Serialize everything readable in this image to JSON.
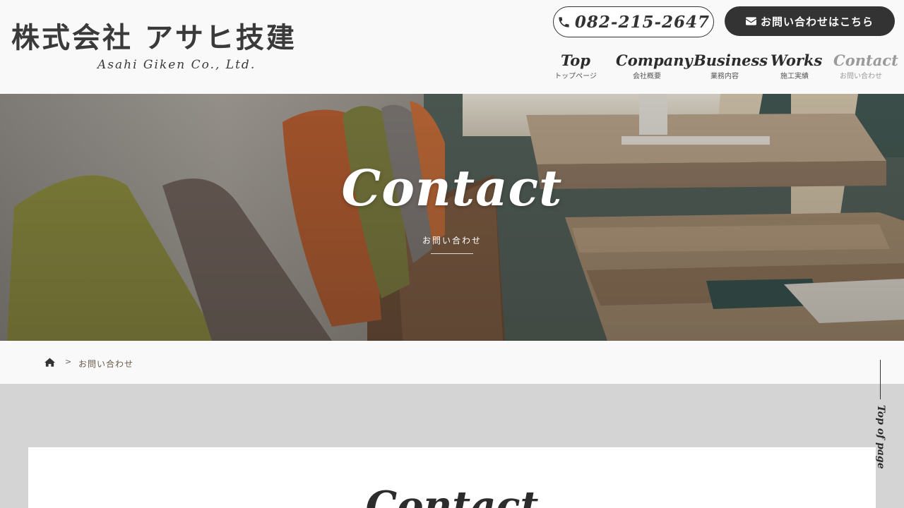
{
  "header": {
    "logo_jp": "株式会社 アサヒ技建",
    "logo_en": "Asahi Giken Co., Ltd.",
    "phone": "082-215-2647",
    "contact_button": "お問い合わせはこちら"
  },
  "nav": {
    "items": [
      {
        "en": "Top",
        "jp": "トップページ"
      },
      {
        "en": "Company",
        "jp": "会社概要"
      },
      {
        "en": "Business",
        "jp": "業務内容"
      },
      {
        "en": "Works",
        "jp": "施工実績"
      },
      {
        "en": "Contact",
        "jp": "お問い合わせ"
      }
    ],
    "active_index": 4
  },
  "hero": {
    "title": "Contact",
    "subtitle": "お問い合わせ"
  },
  "breadcrumb": {
    "home_icon": "home-icon",
    "separator": ">",
    "current": "お問い合わせ"
  },
  "main": {
    "section_title": "Contact"
  },
  "page_top": {
    "label": "Top of page"
  },
  "colors": {
    "header_bg": "#f9f9f9",
    "dark": "#333333",
    "page_bg": "#d4d4d4",
    "active_nav": "#9a9a9a",
    "breadcrumb_text": "#6d5a4a"
  }
}
